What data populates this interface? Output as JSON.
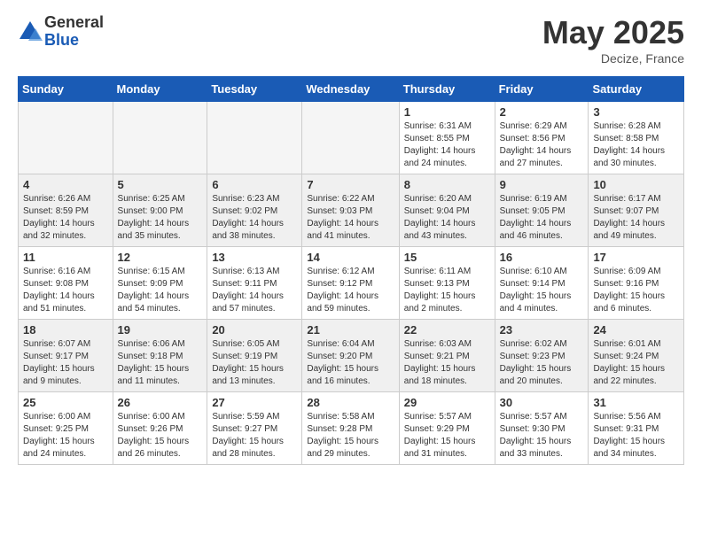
{
  "logo": {
    "general": "General",
    "blue": "Blue"
  },
  "header": {
    "month": "May 2025",
    "location": "Decize, France"
  },
  "weekdays": [
    "Sunday",
    "Monday",
    "Tuesday",
    "Wednesday",
    "Thursday",
    "Friday",
    "Saturday"
  ],
  "weeks": [
    [
      {
        "day": "",
        "info": ""
      },
      {
        "day": "",
        "info": ""
      },
      {
        "day": "",
        "info": ""
      },
      {
        "day": "",
        "info": ""
      },
      {
        "day": "1",
        "info": "Sunrise: 6:31 AM\nSunset: 8:55 PM\nDaylight: 14 hours\nand 24 minutes."
      },
      {
        "day": "2",
        "info": "Sunrise: 6:29 AM\nSunset: 8:56 PM\nDaylight: 14 hours\nand 27 minutes."
      },
      {
        "day": "3",
        "info": "Sunrise: 6:28 AM\nSunset: 8:58 PM\nDaylight: 14 hours\nand 30 minutes."
      }
    ],
    [
      {
        "day": "4",
        "info": "Sunrise: 6:26 AM\nSunset: 8:59 PM\nDaylight: 14 hours\nand 32 minutes."
      },
      {
        "day": "5",
        "info": "Sunrise: 6:25 AM\nSunset: 9:00 PM\nDaylight: 14 hours\nand 35 minutes."
      },
      {
        "day": "6",
        "info": "Sunrise: 6:23 AM\nSunset: 9:02 PM\nDaylight: 14 hours\nand 38 minutes."
      },
      {
        "day": "7",
        "info": "Sunrise: 6:22 AM\nSunset: 9:03 PM\nDaylight: 14 hours\nand 41 minutes."
      },
      {
        "day": "8",
        "info": "Sunrise: 6:20 AM\nSunset: 9:04 PM\nDaylight: 14 hours\nand 43 minutes."
      },
      {
        "day": "9",
        "info": "Sunrise: 6:19 AM\nSunset: 9:05 PM\nDaylight: 14 hours\nand 46 minutes."
      },
      {
        "day": "10",
        "info": "Sunrise: 6:17 AM\nSunset: 9:07 PM\nDaylight: 14 hours\nand 49 minutes."
      }
    ],
    [
      {
        "day": "11",
        "info": "Sunrise: 6:16 AM\nSunset: 9:08 PM\nDaylight: 14 hours\nand 51 minutes."
      },
      {
        "day": "12",
        "info": "Sunrise: 6:15 AM\nSunset: 9:09 PM\nDaylight: 14 hours\nand 54 minutes."
      },
      {
        "day": "13",
        "info": "Sunrise: 6:13 AM\nSunset: 9:11 PM\nDaylight: 14 hours\nand 57 minutes."
      },
      {
        "day": "14",
        "info": "Sunrise: 6:12 AM\nSunset: 9:12 PM\nDaylight: 14 hours\nand 59 minutes."
      },
      {
        "day": "15",
        "info": "Sunrise: 6:11 AM\nSunset: 9:13 PM\nDaylight: 15 hours\nand 2 minutes."
      },
      {
        "day": "16",
        "info": "Sunrise: 6:10 AM\nSunset: 9:14 PM\nDaylight: 15 hours\nand 4 minutes."
      },
      {
        "day": "17",
        "info": "Sunrise: 6:09 AM\nSunset: 9:16 PM\nDaylight: 15 hours\nand 6 minutes."
      }
    ],
    [
      {
        "day": "18",
        "info": "Sunrise: 6:07 AM\nSunset: 9:17 PM\nDaylight: 15 hours\nand 9 minutes."
      },
      {
        "day": "19",
        "info": "Sunrise: 6:06 AM\nSunset: 9:18 PM\nDaylight: 15 hours\nand 11 minutes."
      },
      {
        "day": "20",
        "info": "Sunrise: 6:05 AM\nSunset: 9:19 PM\nDaylight: 15 hours\nand 13 minutes."
      },
      {
        "day": "21",
        "info": "Sunrise: 6:04 AM\nSunset: 9:20 PM\nDaylight: 15 hours\nand 16 minutes."
      },
      {
        "day": "22",
        "info": "Sunrise: 6:03 AM\nSunset: 9:21 PM\nDaylight: 15 hours\nand 18 minutes."
      },
      {
        "day": "23",
        "info": "Sunrise: 6:02 AM\nSunset: 9:23 PM\nDaylight: 15 hours\nand 20 minutes."
      },
      {
        "day": "24",
        "info": "Sunrise: 6:01 AM\nSunset: 9:24 PM\nDaylight: 15 hours\nand 22 minutes."
      }
    ],
    [
      {
        "day": "25",
        "info": "Sunrise: 6:00 AM\nSunset: 9:25 PM\nDaylight: 15 hours\nand 24 minutes."
      },
      {
        "day": "26",
        "info": "Sunrise: 6:00 AM\nSunset: 9:26 PM\nDaylight: 15 hours\nand 26 minutes."
      },
      {
        "day": "27",
        "info": "Sunrise: 5:59 AM\nSunset: 9:27 PM\nDaylight: 15 hours\nand 28 minutes."
      },
      {
        "day": "28",
        "info": "Sunrise: 5:58 AM\nSunset: 9:28 PM\nDaylight: 15 hours\nand 29 minutes."
      },
      {
        "day": "29",
        "info": "Sunrise: 5:57 AM\nSunset: 9:29 PM\nDaylight: 15 hours\nand 31 minutes."
      },
      {
        "day": "30",
        "info": "Sunrise: 5:57 AM\nSunset: 9:30 PM\nDaylight: 15 hours\nand 33 minutes."
      },
      {
        "day": "31",
        "info": "Sunrise: 5:56 AM\nSunset: 9:31 PM\nDaylight: 15 hours\nand 34 minutes."
      }
    ]
  ]
}
